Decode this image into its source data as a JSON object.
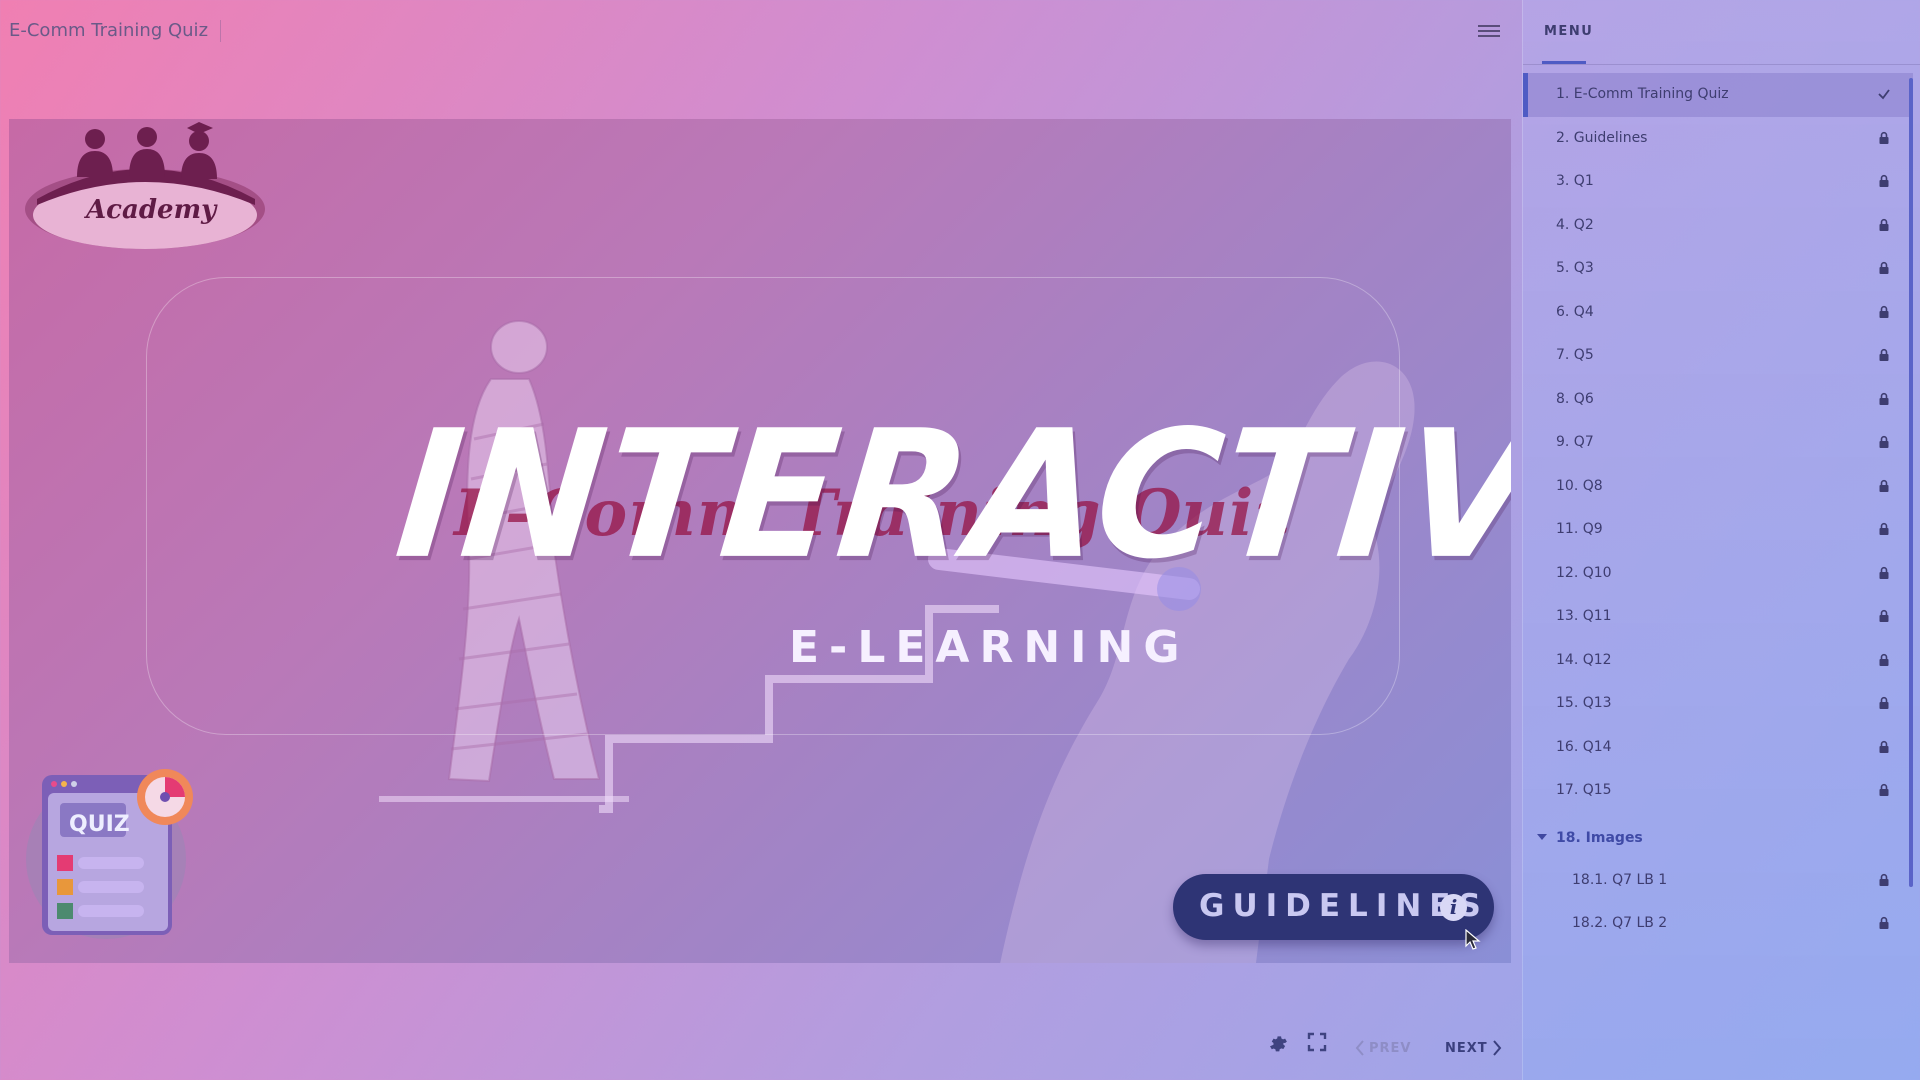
{
  "app": {
    "title": "E-Comm Training Quiz"
  },
  "slide": {
    "logo_text": "Academy",
    "background_text": "E-Comm Training Quiz",
    "main_title": "INTERACTIVE - QUIZ",
    "subtitle": "E-LEARNING",
    "quiz_badge": "QUIZ",
    "guidelines_button": "GUIDELINES"
  },
  "footer": {
    "prev_label": "PREV",
    "next_label": "NEXT"
  },
  "menu": {
    "header": "MENU",
    "items": [
      {
        "label": "1. E-Comm Training Quiz",
        "status": "completed"
      },
      {
        "label": "2. Guidelines",
        "status": "locked"
      },
      {
        "label": "3. Q1",
        "status": "locked"
      },
      {
        "label": "4. Q2",
        "status": "locked"
      },
      {
        "label": "5. Q3",
        "status": "locked"
      },
      {
        "label": "6. Q4",
        "status": "locked"
      },
      {
        "label": "7. Q5",
        "status": "locked"
      },
      {
        "label": "8. Q6",
        "status": "locked"
      },
      {
        "label": "9. Q7",
        "status": "locked"
      },
      {
        "label": "10. Q8",
        "status": "locked"
      },
      {
        "label": "11. Q9",
        "status": "locked"
      },
      {
        "label": "12. Q10",
        "status": "locked"
      },
      {
        "label": "13. Q11",
        "status": "locked"
      },
      {
        "label": "14. Q12",
        "status": "locked"
      },
      {
        "label": "15. Q13",
        "status": "locked"
      },
      {
        "label": "16. Q14",
        "status": "locked"
      },
      {
        "label": "17. Q15",
        "status": "locked"
      }
    ],
    "group": {
      "label": "18. Images",
      "expanded": true,
      "items": [
        {
          "label": "18.1. Q7 LB 1",
          "status": "locked"
        },
        {
          "label": "18.2. Q7 LB 2",
          "status": "locked"
        }
      ]
    }
  },
  "colors": {
    "accent": "#4f5bc4",
    "text": "#3e3d70",
    "guidelines_bg": "#2e3475"
  },
  "icons": {
    "hamburger": "menu-icon",
    "completed": "check-icon",
    "locked": "lock-icon",
    "settings": "gear-icon",
    "fullscreen": "fullscreen-icon",
    "info": "info-icon"
  }
}
